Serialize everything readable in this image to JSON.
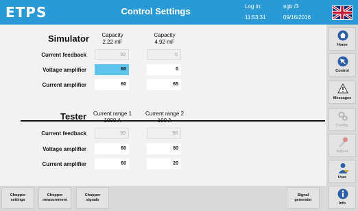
{
  "header": {
    "logo": "ETPS",
    "title": "Control Settings",
    "login_label": "Log In:",
    "login_time": "11:53:31",
    "user": "egb /3",
    "date": "09/16/2016",
    "flag": "uk-flag-icon",
    "bg_color": "#2a9ad6"
  },
  "simulator": {
    "title": "Simulator",
    "col1_head": "Capacity\n2.22 mF",
    "col2_head": "Capacity\n4.92 mF",
    "rows": [
      {
        "label": "Current feedback",
        "v1": "90",
        "v2": "0"
      },
      {
        "label": "Voltage amplifier",
        "v1": "80",
        "v2": "0"
      },
      {
        "label": "Current amplifier",
        "v1": "60",
        "v2": "65"
      }
    ]
  },
  "tester": {
    "title": "Tester",
    "col1_head": "Current range 1\n1000 A",
    "col2_head": "Current range 2\n100 A",
    "rows": [
      {
        "label": "Current feedback",
        "v1": "90",
        "v2": "90"
      },
      {
        "label": "Voltage amplifier",
        "v1": "60",
        "v2": "80"
      },
      {
        "label": "Current amplifier",
        "v1": "60",
        "v2": "20"
      }
    ]
  },
  "sidebar": [
    {
      "label": "Home",
      "icon": "home-icon"
    },
    {
      "label": "Control",
      "icon": "control-icon"
    },
    {
      "label": "Messages",
      "icon": "warning-icon"
    },
    {
      "label": "Config.",
      "icon": "config-icon"
    },
    {
      "label": "Adjust",
      "icon": "adjust-icon"
    },
    {
      "label": "User",
      "icon": "user-icon"
    },
    {
      "label": "Info",
      "icon": "info-icon"
    }
  ],
  "bottom": {
    "chopper_settings": "Chopper\nsettings",
    "chopper_measurement": "Chopper\nmeasurement",
    "chopper_signals": "Chopper\nsignals",
    "signal_generator": "Signal\ngenerator"
  },
  "colors": {
    "selected_field": "#5ec4ee",
    "accent": "#2a9ad6"
  }
}
